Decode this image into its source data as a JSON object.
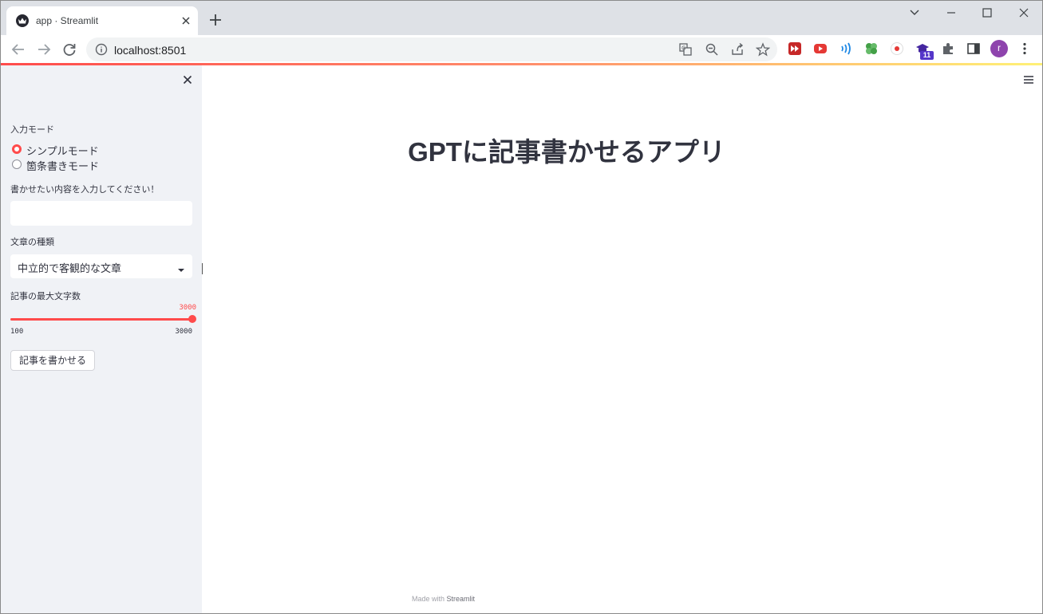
{
  "browser": {
    "tab_title": "app · Streamlit",
    "url": "localhost:8501",
    "extension_badge": "11",
    "profile_initial": "r",
    "icons": {
      "favicon": "streamlit-crown-icon",
      "tab_close": "close-icon",
      "new_tab": "plus-icon",
      "back": "arrow-left-icon",
      "forward": "arrow-right-icon",
      "reload": "reload-icon",
      "site_info": "info-icon",
      "translate": "translate-icon",
      "zoom": "zoom-out-icon",
      "share": "share-icon",
      "bookmark": "star-icon",
      "extensions": "puzzle-icon",
      "side_panel": "side-panel-icon",
      "menu": "kebab-icon"
    }
  },
  "sidebar": {
    "input_mode_label": "入力モード",
    "radio_options": [
      "シンプルモード",
      "箇条書きモード"
    ],
    "selected_radio": 0,
    "content_label": "書かせたい内容を入力してください！",
    "content_value": "",
    "style_label": "文章の種類",
    "style_selected": "中立的で客観的な文章",
    "length_label": "記事の最大文字数",
    "slider": {
      "min": "100",
      "max": "3000",
      "value": "3000",
      "fraction": 1.0
    },
    "submit_label": "記事を書かせる"
  },
  "main": {
    "title": "GPTに記事書かせるアプリ",
    "footer_prefix": "Made with ",
    "footer_brand": "Streamlit"
  },
  "colors": {
    "accent": "#ff4b4b",
    "sidebar_bg": "#f0f2f6",
    "text": "#31333f"
  }
}
